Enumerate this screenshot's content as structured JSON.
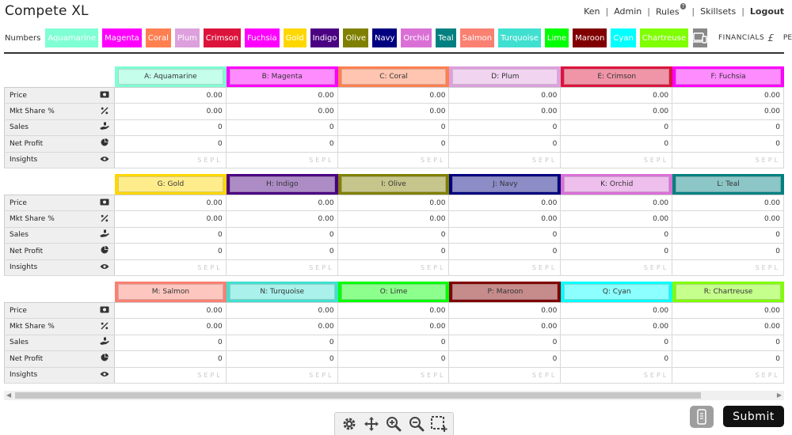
{
  "app": {
    "title": "Compete XL"
  },
  "nav": {
    "user": "Ken",
    "admin": "Admin",
    "rules": "Rules",
    "rules_badge": "?",
    "skillsets": "Skillsets",
    "logout": "Logout"
  },
  "teambar": {
    "label": "Numbers",
    "teams": [
      {
        "name": "Aquamarine",
        "color": "#7fffd4",
        "text": "#ffffff"
      },
      {
        "name": "Magenta",
        "color": "#ff00ff",
        "text": "#ffffff"
      },
      {
        "name": "Coral",
        "color": "#ff7f50",
        "text": "#ffffff"
      },
      {
        "name": "Plum",
        "color": "#dda0dd",
        "text": "#ffffff"
      },
      {
        "name": "Crimson",
        "color": "#dc143c",
        "text": "#ffffff"
      },
      {
        "name": "Fuchsia",
        "color": "#ff00ff",
        "text": "#ffffff"
      },
      {
        "name": "Gold",
        "color": "#ffd700",
        "text": "#ffffff"
      },
      {
        "name": "Indigo",
        "color": "#4b0082",
        "text": "#ffffff"
      },
      {
        "name": "Olive",
        "color": "#808000",
        "text": "#ffffff"
      },
      {
        "name": "Navy",
        "color": "#000080",
        "text": "#ffffff"
      },
      {
        "name": "Orchid",
        "color": "#da70d6",
        "text": "#ffffff"
      },
      {
        "name": "Teal",
        "color": "#008080",
        "text": "#ffffff"
      },
      {
        "name": "Salmon",
        "color": "#fa8072",
        "text": "#ffffff"
      },
      {
        "name": "Turquoise",
        "color": "#40e0d0",
        "text": "#ffffff"
      },
      {
        "name": "Lime",
        "color": "#00ff00",
        "text": "#ffffff"
      },
      {
        "name": "Maroon",
        "color": "#800000",
        "text": "#ffffff"
      },
      {
        "name": "Cyan",
        "color": "#00ffff",
        "text": "#ffffff"
      },
      {
        "name": "Chartreuse",
        "color": "#7fff00",
        "text": "#ffffff"
      }
    ],
    "financials": "FINANCIALS",
    "financials_icon": "£",
    "pe": "PE"
  },
  "row_labels": [
    {
      "label": "Price",
      "icon": "money-icon"
    },
    {
      "label": "Mkt Share %",
      "icon": "percent-icon"
    },
    {
      "label": "Sales",
      "icon": "sales-hand-icon"
    },
    {
      "label": "Net Profit",
      "icon": "pie-icon"
    },
    {
      "label": "Insights",
      "icon": "eye-icon"
    }
  ],
  "sections": [
    {
      "teams": [
        {
          "label": "A: Aquamarine",
          "color": "#7fffd4"
        },
        {
          "label": "B: Magenta",
          "color": "#ff00ff"
        },
        {
          "label": "C: Coral",
          "color": "#ff7f50"
        },
        {
          "label": "D: Plum",
          "color": "#dda0dd"
        },
        {
          "label": "E: Crimson",
          "color": "#dc143c"
        },
        {
          "label": "F: Fuchsia",
          "color": "#ff00ff"
        }
      ]
    },
    {
      "teams": [
        {
          "label": "G: Gold",
          "color": "#ffd700"
        },
        {
          "label": "H: Indigo",
          "color": "#4b0082"
        },
        {
          "label": "I: Olive",
          "color": "#808000"
        },
        {
          "label": "J: Navy",
          "color": "#000080"
        },
        {
          "label": "K: Orchid",
          "color": "#da70d6"
        },
        {
          "label": "L: Teal",
          "color": "#008080"
        }
      ]
    },
    {
      "teams": [
        {
          "label": "M: Salmon",
          "color": "#fa8072"
        },
        {
          "label": "N: Turquoise",
          "color": "#40e0d0"
        },
        {
          "label": "O: Lime",
          "color": "#00ff00"
        },
        {
          "label": "P: Maroon",
          "color": "#800000"
        },
        {
          "label": "Q: Cyan",
          "color": "#00ffff"
        },
        {
          "label": "R: Chartreuse",
          "color": "#7fff00"
        }
      ]
    }
  ],
  "cell_values": {
    "price": "0.00",
    "mkt_share": "0.00",
    "sales": "0",
    "net_profit": "0",
    "insights": "SEPL"
  },
  "toolbar": {
    "icons": [
      "gear-icon",
      "move-icon",
      "zoom-in-icon",
      "zoom-out-icon",
      "select-area-icon"
    ]
  },
  "submit": {
    "label": "Submit"
  }
}
